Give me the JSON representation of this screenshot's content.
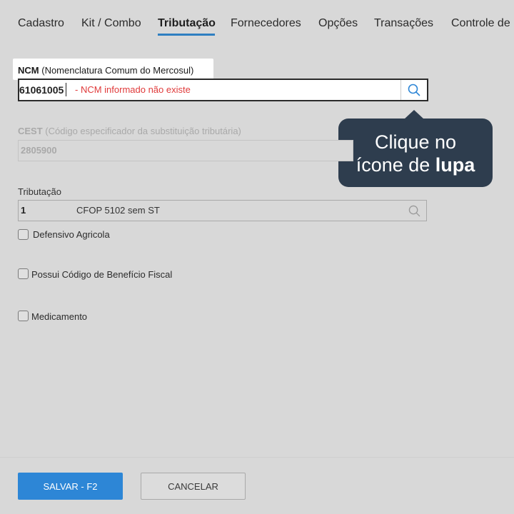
{
  "tabs": [
    {
      "label": "Cadastro"
    },
    {
      "label": "Kit / Combo"
    },
    {
      "label": "Tributação",
      "active": true
    },
    {
      "label": "Fornecedores"
    },
    {
      "label": "Opções"
    },
    {
      "label": "Transações"
    },
    {
      "label": "Controle de"
    }
  ],
  "ncm": {
    "label_bold": "NCM",
    "label_rest": "(Nomenclatura Comum do Mercosul)",
    "value": "61061005",
    "error": "- NCM informado não existe",
    "search_icon": "search-icon"
  },
  "tooltip": {
    "line1": "Clique no",
    "line2_prefix": "ícone de",
    "line2_bold": "lupa"
  },
  "cest": {
    "label_bold": "CEST",
    "label_rest": "(Código especificador da substituição tributária)",
    "value": "2805900"
  },
  "tributacao": {
    "label": "Tributação",
    "code": "1",
    "description": "CFOP 5102 sem ST",
    "search_icon": "search-icon"
  },
  "checkboxes": [
    {
      "label": "Defensivo Agricola",
      "checked": false
    },
    {
      "label": "Possui Código de Benefício Fiscal",
      "checked": false
    },
    {
      "label": "Medicamento",
      "checked": false
    }
  ],
  "footer": {
    "save_label": "SALVAR - F2",
    "cancel_label": "CANCELAR"
  },
  "colors": {
    "accent": "#2d86d6",
    "error": "#e03a3a",
    "tooltip_bg": "#2e3d4e",
    "overlay_bg": "#d8d8d8"
  }
}
